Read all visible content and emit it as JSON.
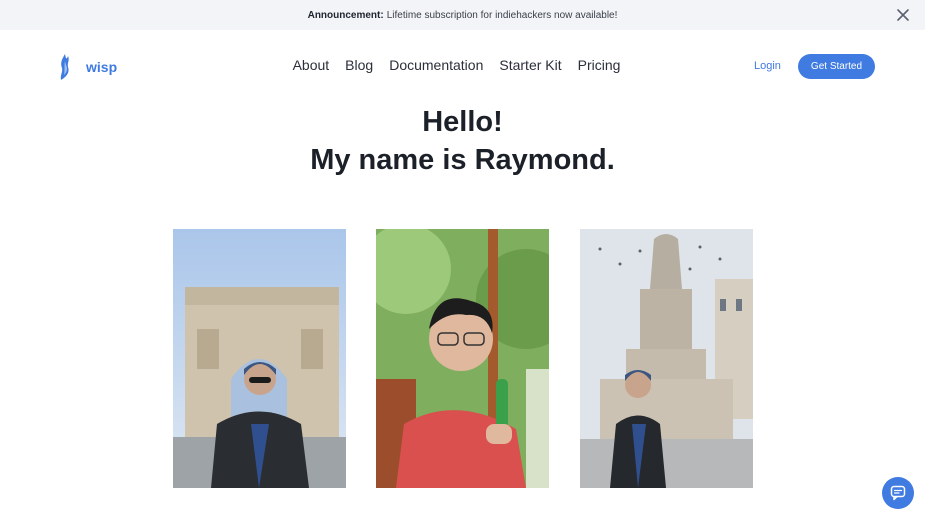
{
  "announcement": {
    "label": "Announcement:",
    "text": "Lifetime subscription for indiehackers now available!"
  },
  "brand": {
    "name": "wisp",
    "accent": "#3f7be0"
  },
  "nav": [
    {
      "label": "About"
    },
    {
      "label": "Blog"
    },
    {
      "label": "Documentation"
    },
    {
      "label": "Starter Kit"
    },
    {
      "label": "Pricing"
    }
  ],
  "auth": {
    "login_label": "Login",
    "cta_label": "Get Started"
  },
  "hero": {
    "line1": "Hello!",
    "line2": "My name is Raymond."
  },
  "icons": {
    "close": "close-icon",
    "chat": "chat-icon"
  }
}
